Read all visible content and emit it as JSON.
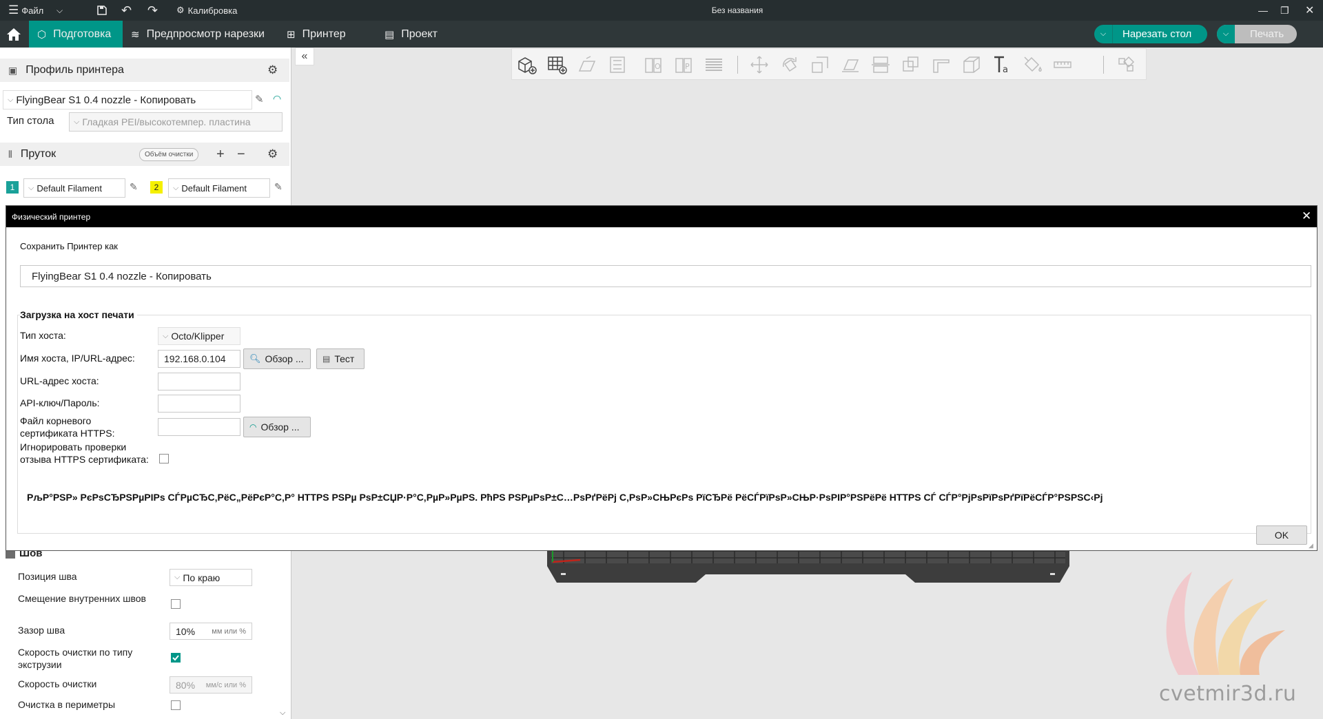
{
  "titlebar": {
    "file_label": "Файл",
    "calibration_label": "Калибровка",
    "title": "Без названия"
  },
  "toolbar": {
    "tabs": [
      "Подготовка",
      "Предпросмотр нарезки",
      "Принтер",
      "Проект"
    ],
    "slice_label": "Нарезать стол",
    "print_label": "Печать"
  },
  "sidebar": {
    "printer_header": "Профиль принтера",
    "printer_profile": "FlyingBear S1 0.4 nozzle - Копировать",
    "bed_type_label": "Тип стола",
    "bed_type_value": "Гладкая PEI/высокотемпер. пластина",
    "filament_header": "Пруток",
    "flush_volume_label": "Объём очистки",
    "filaments": [
      {
        "index": "1",
        "name": "Default Filament",
        "color": "#1aa199"
      },
      {
        "index": "2",
        "name": "Default Filament",
        "color": "#f5f000"
      }
    ],
    "seam_header": "Шов",
    "seam_position_label": "Позиция шва",
    "seam_position_value": "По краю",
    "inner_seam_offset_label": "Смещение внутренних швов",
    "seam_gap_label": "Зазор шва",
    "seam_gap_value": "10%",
    "seam_gap_unit": "мм или %",
    "wipe_speed_by_type_label": "Скорость очистки по типу экструзии",
    "wipe_speed_label": "Скорость очистки",
    "wipe_speed_value": "80%",
    "wipe_speed_unit": "мм/с или %",
    "wipe_perimeters_label": "Очистка в периметры"
  },
  "dialog": {
    "title": "Физический принтер",
    "save_as_label": "Сохранить Принтер как",
    "printer_name_value": "FlyingBear S1 0.4 nozzle - Копировать",
    "upload_group": "Загрузка на хост печати",
    "host_type_label": "Тип хоста:",
    "host_type_value": "Octo/Klipper",
    "hostname_label": "Имя хоста, IP/URL-адрес:",
    "hostname_value": "192.168.0.104",
    "browse_label": "Обзор ...",
    "test_label": "Тест",
    "host_url_label": "URL-адрес хоста:",
    "api_key_label": "API-ключ/Пароль:",
    "cert_label": "Файл корневого сертификата HTTPS:",
    "ignore_cert_label": "Игнорировать проверки отзыва HTTPS сертификата:",
    "garbled_note": "РљР°РЅР» РєРѕСЂРЅРµРІРѕ СЃРµСЂС‚РёС„РёРєР°С‚Р° HTTPS РЅРµ РѕР±СЏР·Р°С‚РµР»РµРЅ. РћРЅ РЅРµРѕР±С…РѕРґРёРј С‚РѕР»СЊРєРѕ РїСЂРё РёСЃРїРѕР»СЊР·РѕРІР°РЅРёРё HTTPS СЃ СЃР°РјРѕРїРѕРґРїРёСЃР°РЅРЅС‹Рј",
    "ok_label": "OK"
  },
  "watermark": "cvetmir3d.ru",
  "colors": {
    "accent": "#009688",
    "titlebar": "#262e30",
    "toolbar": "#2f3739"
  }
}
